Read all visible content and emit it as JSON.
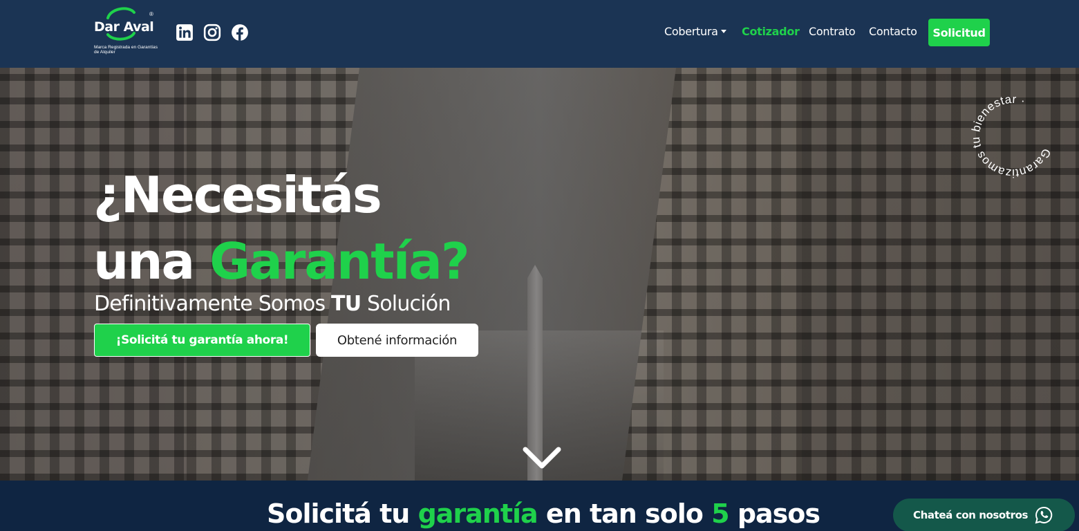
{
  "brand": {
    "name": "Dar Aval",
    "registered": "®",
    "tagline": "Marca Registrada en Garantías de Alquiler"
  },
  "social": {
    "icons": [
      "linkedin-icon",
      "instagram-icon",
      "facebook-icon"
    ]
  },
  "nav": {
    "cobertura": "Cobertura",
    "cotizador": "Cotizador",
    "contrato": "Contrato",
    "contacto": "Contacto",
    "solicitud": "Solicitud"
  },
  "hero": {
    "title_line1": "¿Necesitás",
    "title_line2_prefix": "una ",
    "title_line2_highlight": "Garantía?",
    "subtitle_prefix": "Definitivamente Somos ",
    "subtitle_bold": "TU",
    "subtitle_suffix": " Solución",
    "cta_primary": "¡Solicitá tu garantía ahora!",
    "cta_secondary": "Obtené información",
    "badge_text": "Garantizamos tu bienestar ·"
  },
  "steps": {
    "title_prefix": "Solicitá tu ",
    "title_highlight1": "garantía",
    "title_middle": " en tan solo ",
    "title_highlight2": "5",
    "title_suffix": " pasos"
  },
  "chat": {
    "label": "Chateá con nosotros"
  },
  "colors": {
    "accent_green": "#1fd14b",
    "navbar_bg": "#1b3454",
    "section_bg": "#0f2542",
    "chat_bg": "#14584a"
  }
}
